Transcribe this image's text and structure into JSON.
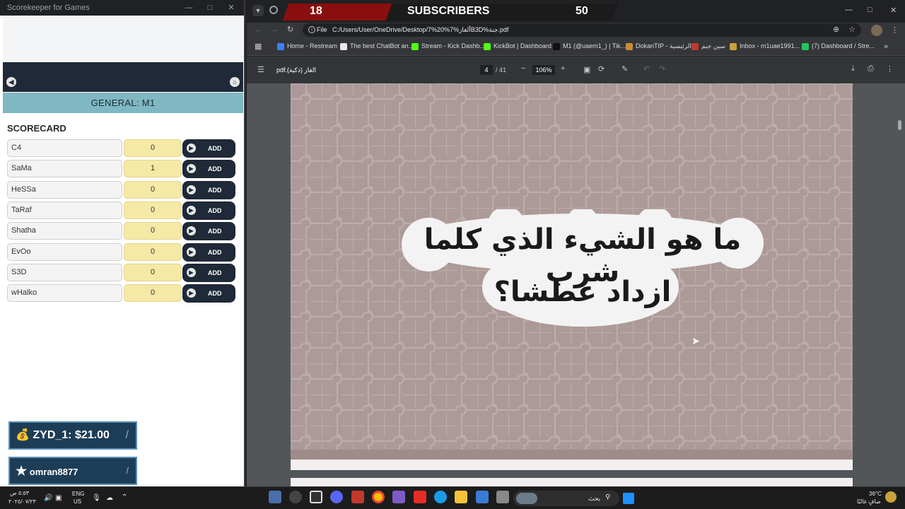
{
  "scorekeeper": {
    "window_title": "Scorekeeper for Games",
    "general_label": "GENERAL: M1",
    "scorecard_label": "SCORECARD",
    "add_label": "ADD",
    "players": [
      {
        "name": "C4",
        "score": "0"
      },
      {
        "name": "SaMa",
        "score": "1"
      },
      {
        "name": "HeSSa",
        "score": "0"
      },
      {
        "name": "TaRaf",
        "score": "0"
      },
      {
        "name": "Shatha",
        "score": "0"
      },
      {
        "name": "EvOo",
        "score": "0"
      },
      {
        "name": "S3D",
        "score": "0"
      },
      {
        "name": "wHalko",
        "score": "0"
      }
    ]
  },
  "overlays": {
    "donation": "ZYD_1: $21.00",
    "follower": "omran8877"
  },
  "subscribers": {
    "current": "18",
    "label": "SUBSCRIBERS",
    "goal": "50"
  },
  "browser": {
    "url_scheme": "File",
    "url": "C:/Users/User/OneDrive/Desktop/7%20%ألغاز%7B3D%جنة.pdf",
    "bookmarks": [
      "Home - Restream",
      "The best ChatBot an...",
      "Stream - Kick Dashb...",
      "KickBot | Dashboard",
      "M1 (@uaem1_) | Tik...",
      "DokanTIP - الرئيسية",
      "سين جيم",
      "Inbox - m1uae1991...",
      "(7) Dashboard / Stre..."
    ]
  },
  "pdf": {
    "filename": "الغاز (ذكية).pdf",
    "page": "4",
    "total_pages": "/ 41",
    "zoom": "106%",
    "question_line1": "ما هو الشيء الذي كلما شرب",
    "question_line2": "ازداد عطشا؟"
  },
  "taskbar": {
    "time": "٥:٥٣ ص",
    "date": "٢٠٢٥/٠٧/٢٣",
    "lang": "ENG",
    "region": "US",
    "search_placeholder": "بحث",
    "temperature": "36°C",
    "weather": "صافٍ غالبًا"
  },
  "colors": {
    "nav_dark": "#1f2937",
    "general_bar": "#7fb8c2",
    "score_yellow": "#f6e9a6",
    "puzzle_bg": "#ac9a98",
    "subs_red": "#8b0e0e"
  }
}
